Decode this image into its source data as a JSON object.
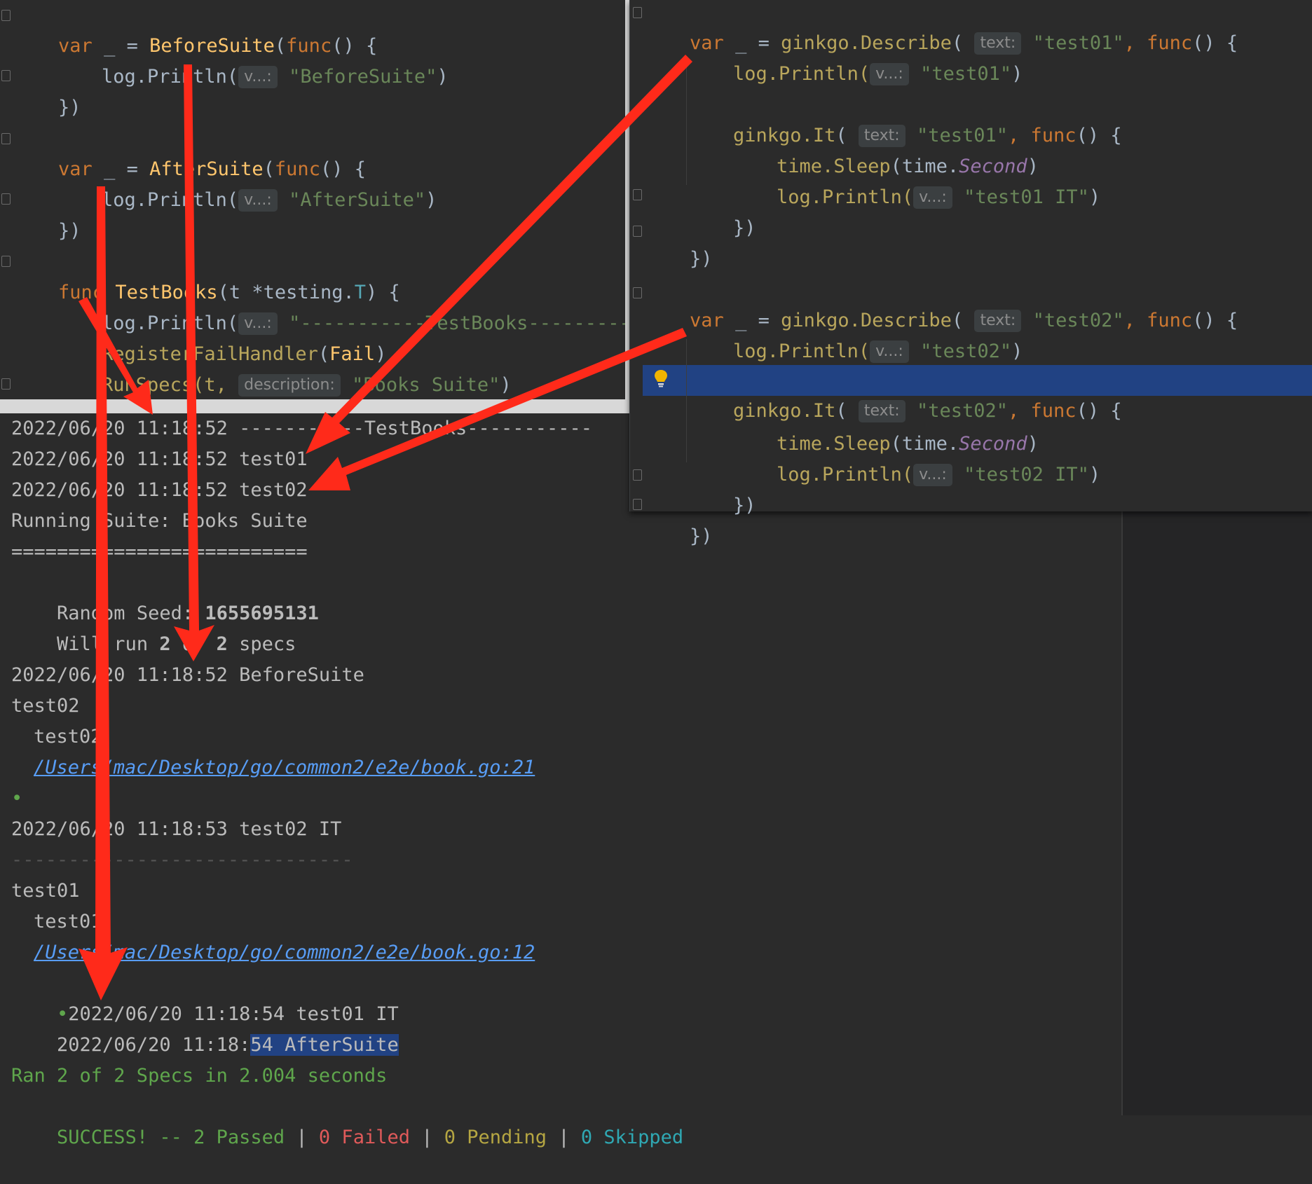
{
  "left_editor": {
    "lines": [
      {
        "kw": "var",
        "rest": " _ = ",
        "fn": "BeforeSuite",
        "p1": "(",
        "kw2": "func",
        "p2": "() {"
      },
      {
        "pkg": "log.Println(",
        "hint": "v...:",
        "str": "\"BeforeSuite\"",
        "end": ")"
      },
      {
        "text": "})"
      },
      {
        "kw": "var",
        "rest": " _ = ",
        "fn": "AfterSuite",
        "p1": "(",
        "kw2": "func",
        "p2": "() {"
      },
      {
        "pkg": "log.Println(",
        "hint": "v...:",
        "str": "\"AfterSuite\"",
        "end": ")"
      },
      {
        "text": "})"
      },
      {
        "kw": "func",
        "fn": "TestBooks",
        "sig_a": "(t *",
        "sig_type": "testing.",
        "sig_T": "T",
        "sig_b": ") {"
      },
      {
        "pkg": "log.Println(",
        "hint": "v...:",
        "str": "\"-----------TestBooks-----------\"",
        "end": ")"
      },
      {
        "fn": "RegisterFailHandler",
        "p1": "(",
        "arg": "Fail",
        "end": ")"
      },
      {
        "pkg": "RunSpecs(t, ",
        "hint": "description:",
        "str": "\"Books Suite\"",
        "end": ")"
      },
      {
        "text": "}"
      }
    ]
  },
  "right_editor": {
    "lines": [
      {
        "kw": "var",
        "rest": " _ = ",
        "pkg": "ginkgo.",
        "fn": "Describe",
        "p1": "( ",
        "hint": "text:",
        "str": "\"test01\"",
        "p2": ", ",
        "kw2": "func",
        "p3": "() {"
      },
      {
        "pkg": "log.Println(",
        "hint": "v...:",
        "str": "\"test01\"",
        "end": ")"
      },
      {
        "pkg": "ginkgo.",
        "fn": "It",
        "p1": "( ",
        "hint": "text:",
        "str": "\"test01\"",
        "p2": ", ",
        "kw2": "func",
        "p3": "() {"
      },
      {
        "pkg": "time.",
        "fn": "Sleep",
        "p1": "(time.",
        "it": "Second",
        "end": ")"
      },
      {
        "pkg": "log.Println(",
        "hint": "v...:",
        "str": "\"test01 IT\"",
        "end": ")"
      },
      {
        "text": "})"
      },
      {
        "text": "})"
      },
      {
        "kw": "var",
        "rest": " _ = ",
        "pkg": "ginkgo.",
        "fn": "Describe",
        "p1": "( ",
        "hint": "text:",
        "str": "\"test02\"",
        "p2": ", ",
        "kw2": "func",
        "p3": "() {"
      },
      {
        "pkg": "log.Println(",
        "hint": "v...:",
        "str": "\"test02\"",
        "end": ")"
      },
      {
        "pkg": "ginkgo.",
        "fn": "It",
        "p1": "( ",
        "hint": "text:",
        "str": "\"test02\"",
        "p2": ", ",
        "kw2": "func",
        "p3": "() {"
      },
      {
        "pkg": "time.",
        "fn": "Sleep",
        "p1": "(time.",
        "it": "Second",
        "end": ")"
      },
      {
        "pkg": "log.Println(",
        "hint": "v...:",
        "str": "\"test02 IT\"",
        "end": ")"
      },
      {
        "text": "})"
      },
      {
        "text": "})"
      }
    ]
  },
  "console": {
    "l1": "2022/06/20 11:18:52 -----------TestBooks-----------",
    "l2": "2022/06/20 11:18:52 test01",
    "l3": "2022/06/20 11:18:52 test02",
    "l4": "Running Suite: Books Suite",
    "l5": "==========================",
    "l6a": "Random Seed: ",
    "l6b": "1655695131",
    "l7a": "Will run ",
    "l7b": "2",
    "l7c": " of ",
    "l7d": "2",
    "l7e": " specs",
    "l8": "2022/06/20 11:18:52 BeforeSuite",
    "l9": "test02",
    "l10": "test02",
    "l11": "/Users/mac/Desktop/go/common2/e2e/book.go:21",
    "l12": "•",
    "l13": "2022/06/20 11:18:53 test02 IT",
    "l14": "------------------------------",
    "l15": "test01",
    "l16": "test01",
    "l17": "/Users/mac/Desktop/go/common2/e2e/book.go:12",
    "l18a": "•",
    "l18b": "2022/06/20 11:18:54 test01 IT",
    "l19a": "2022/06/20 11:18:",
    "l19b": "54 AfterSuite",
    "l20": "Ran 2 of 2 Specs in 2.004 seconds",
    "l21a": "SUCCESS! -- 2 Passed",
    "l21b": " | ",
    "l21c": "0 Failed",
    "l21d": " | ",
    "l21e": "0 Pending",
    "l21f": " | ",
    "l21g": "0 Skipped"
  },
  "colors": {
    "annotation_arrow": "#ff2a1a",
    "selection": "#214283",
    "success": "#5fa64c"
  }
}
